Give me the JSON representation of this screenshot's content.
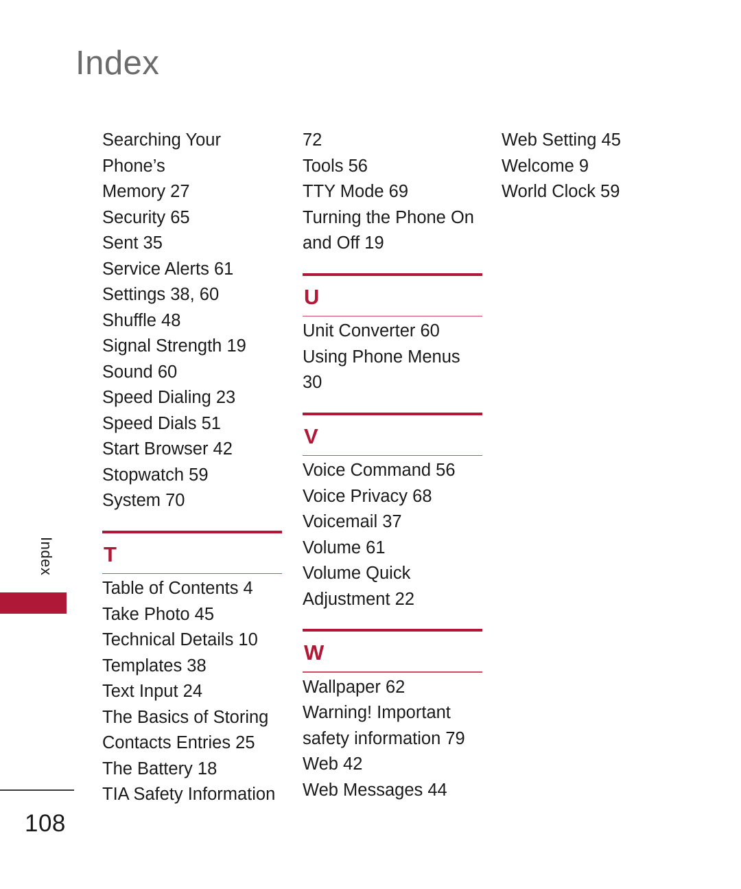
{
  "page": {
    "title": "Index",
    "side_tab_label": "Index",
    "page_number": "108",
    "accent_color": "#b01838",
    "rule_thin_color": "#cf4a63",
    "title_color": "#6b6b6b",
    "text_color": "#1a1a1a"
  },
  "columns": [
    {
      "id": "column-1",
      "blocks": [
        {
          "type": "entries",
          "entries": [
            "Searching Your Phone’s\nMemory 27",
            "Security 65",
            "Sent 35",
            "Service Alerts 61",
            "Settings 38, 60",
            "Shuffle 48",
            "Signal Strength 19",
            "Sound 60",
            "Speed Dialing 23",
            "Speed Dials 51",
            "Start Browser 42",
            "Stopwatch 59",
            "System 70"
          ]
        },
        {
          "type": "section",
          "letter": "T",
          "entries": [
            "Table of Contents 4",
            "Take Photo 45",
            "Technical Details 10",
            "Templates 38",
            "Text Input 24",
            "The Basics of Storing\nContacts Entries 25",
            "The Battery 18",
            "TIA Safety Information"
          ]
        }
      ]
    },
    {
      "id": "column-2",
      "blocks": [
        {
          "type": "entries",
          "entries": [
            "72",
            "Tools 56",
            "TTY Mode 69",
            "Turning the Phone On\nand Off 19"
          ]
        },
        {
          "type": "section",
          "letter": "U",
          "entries": [
            "Unit Converter 60",
            "Using Phone Menus\n30"
          ]
        },
        {
          "type": "section",
          "letter": "V",
          "entries": [
            "Voice Command 56",
            "Voice Privacy 68",
            "Voicemail 37",
            "Volume 61",
            "Volume Quick\nAdjustment 22"
          ]
        },
        {
          "type": "section",
          "letter": "W",
          "entries": [
            "Wallpaper 62",
            "Warning! Important\nsafety information 79",
            "Web 42",
            "Web Messages 44"
          ]
        }
      ]
    },
    {
      "id": "column-3",
      "blocks": [
        {
          "type": "entries",
          "entries": [
            "Web Setting 45",
            "Welcome 9",
            "World Clock 59"
          ]
        }
      ]
    }
  ]
}
